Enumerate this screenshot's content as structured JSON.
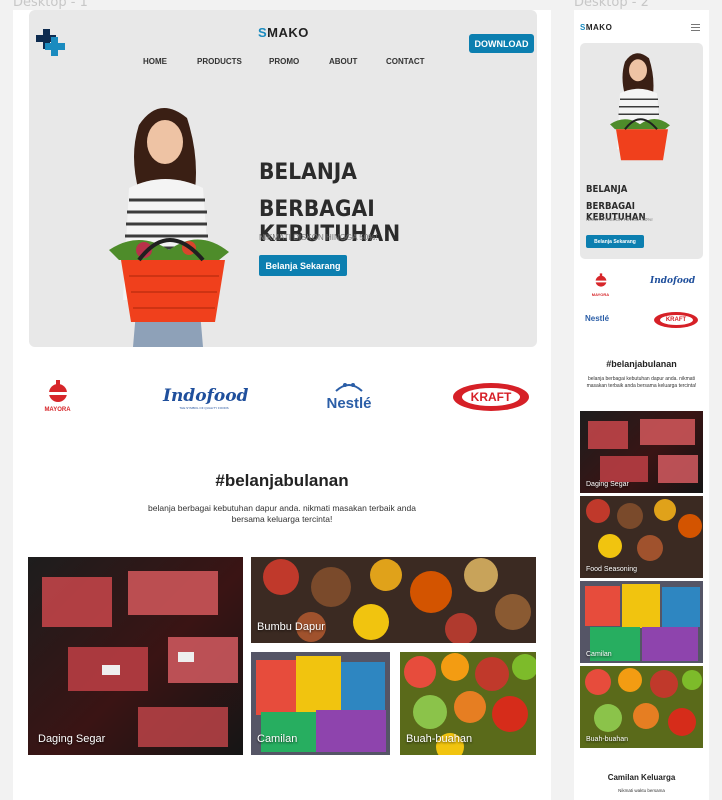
{
  "frames": {
    "desktop1": "Desktop - 1",
    "desktop2": "Desktop - 2"
  },
  "brand": {
    "prefix": "S",
    "rest": "MAKO"
  },
  "nav": [
    "HOME",
    "PRODUCTS",
    "PROMO",
    "ABOUT",
    "CONTACT"
  ],
  "download_label": "DOWNLOAD",
  "hero": {
    "line1": "BELANJA",
    "line2": "BERBAGAI KEBUTUHAN",
    "subtitle": "NIKMATI DISKON HINGGA 50%!",
    "cta": "Belanja Sekarang"
  },
  "brands": {
    "mayora": "MAYORA",
    "indofood": "Indofood",
    "indofood_tag": "THE SYMBOL OF QUALITY FOODS",
    "nestle": "Nestlé",
    "kraft": "KRAFT"
  },
  "section": {
    "title": "#belanjabulanan",
    "desc": "belanja berbagai kebutuhan dapur anda. nikmati masakan terbaik anda bersama keluarga tercinta!"
  },
  "categories_desktop": [
    "Daging Segar",
    "Bumbu Dapur",
    "Camilan",
    "Buah-buahan"
  ],
  "categories_mobile": [
    "Daging Segar",
    "Food Seasoning",
    "Camilan",
    "Buah-buahan"
  ],
  "mobile_footer": {
    "title": "Camilan Keluarga",
    "desc": "Nikmati waktu bersama"
  },
  "colors": {
    "accent": "#0c7fb0",
    "brand_s": "#1a8bbf",
    "kraft_red": "#d62027",
    "nestle_blue": "#2b5ea7",
    "mayora_red": "#d7262a"
  }
}
